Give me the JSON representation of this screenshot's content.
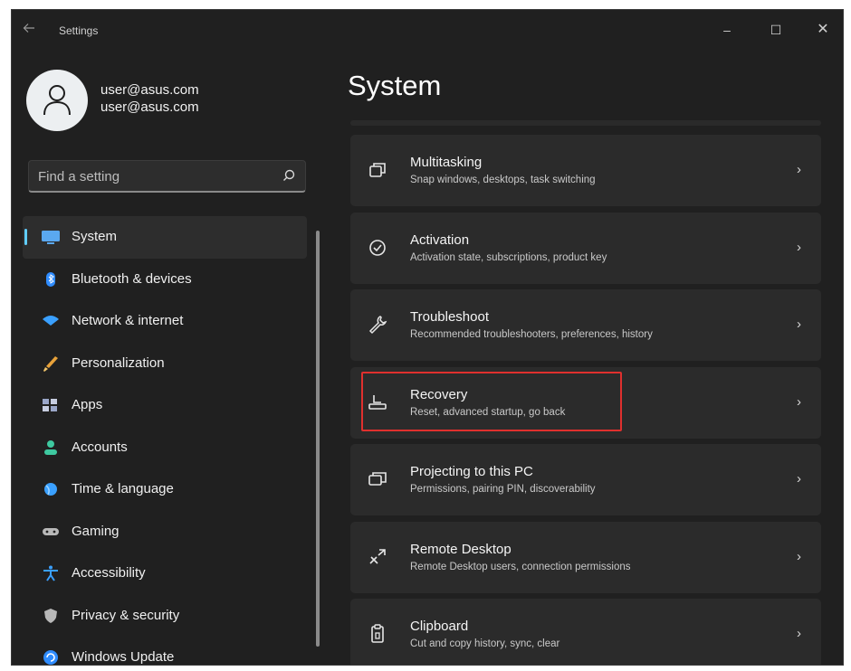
{
  "window": {
    "title": "Settings",
    "controls": {
      "minimize": "–",
      "maximize": "☐",
      "close": "✕"
    }
  },
  "profile": {
    "line1": "user@asus.com",
    "line2": "user@asus.com"
  },
  "search": {
    "placeholder": "Find a setting"
  },
  "sidebar": {
    "items": [
      {
        "label": "System",
        "icon": "monitor-icon",
        "selected": true,
        "color": "#5aa8f0"
      },
      {
        "label": "Bluetooth & devices",
        "icon": "bluetooth-icon",
        "color": "#2f8cff"
      },
      {
        "label": "Network & internet",
        "icon": "wifi-icon",
        "color": "#3aa0ff"
      },
      {
        "label": "Personalization",
        "icon": "brush-icon",
        "color": "#e8a23a"
      },
      {
        "label": "Apps",
        "icon": "apps-icon",
        "color": "#9aa6c8"
      },
      {
        "label": "Accounts",
        "icon": "person-icon",
        "color": "#3ec9a0"
      },
      {
        "label": "Time & language",
        "icon": "globe-clock-icon",
        "color": "#3aa0ff"
      },
      {
        "label": "Gaming",
        "icon": "gamepad-icon",
        "color": "#b8b8b8"
      },
      {
        "label": "Accessibility",
        "icon": "accessibility-icon",
        "color": "#3aa0ff"
      },
      {
        "label": "Privacy & security",
        "icon": "shield-icon",
        "color": "#b8b8b8"
      },
      {
        "label": "Windows Update",
        "icon": "update-icon",
        "color": "#2f8cff"
      }
    ],
    "accent": "#60cdff"
  },
  "main": {
    "title": "System",
    "cards": [
      {
        "title": "Multitasking",
        "subtitle": "Snap windows, desktops, task switching",
        "icon": "multitasking-icon"
      },
      {
        "title": "Activation",
        "subtitle": "Activation state, subscriptions, product key",
        "icon": "check-circle-icon"
      },
      {
        "title": "Troubleshoot",
        "subtitle": "Recommended troubleshooters, preferences, history",
        "icon": "wrench-icon"
      },
      {
        "title": "Recovery",
        "subtitle": "Reset, advanced startup, go back",
        "icon": "recovery-icon",
        "highlighted": true
      },
      {
        "title": "Projecting to this PC",
        "subtitle": "Permissions, pairing PIN, discoverability",
        "icon": "projecting-icon"
      },
      {
        "title": "Remote Desktop",
        "subtitle": "Remote Desktop users, connection permissions",
        "icon": "remote-desktop-icon"
      },
      {
        "title": "Clipboard",
        "subtitle": "Cut and copy history, sync, clear",
        "icon": "clipboard-icon"
      }
    ],
    "chevron": "›",
    "highlight_color": "#e0302e"
  }
}
